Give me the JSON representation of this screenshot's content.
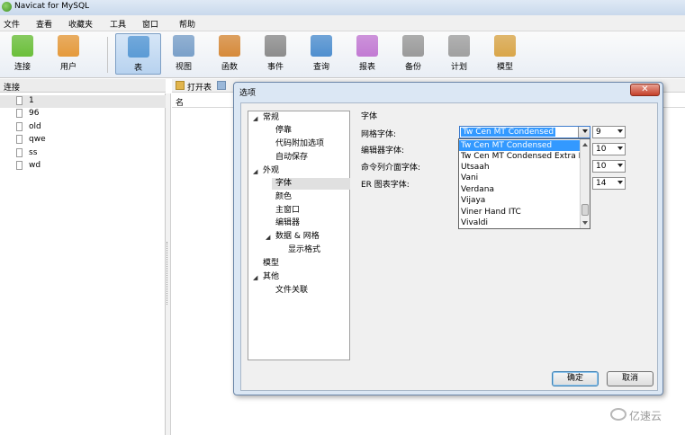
{
  "window": {
    "title": "Navicat for MySQL"
  },
  "menubar": [
    "文件",
    "查看",
    "收藏夹",
    "工具",
    "窗口",
    "帮助"
  ],
  "toolbar": [
    {
      "label": "连接",
      "icon": "connection-icon",
      "color": "#6bbf3a"
    },
    {
      "label": "用户",
      "icon": "user-icon",
      "color": "#e59a3c"
    },
    {
      "label": "表",
      "icon": "table-icon",
      "color": "#5b9bd5",
      "active": true
    },
    {
      "label": "视图",
      "icon": "view-icon",
      "color": "#7aa0c9"
    },
    {
      "label": "函数",
      "icon": "function-icon",
      "color": "#d68a3a"
    },
    {
      "label": "事件",
      "icon": "event-icon",
      "color": "#8c8c8c"
    },
    {
      "label": "查询",
      "icon": "query-icon",
      "color": "#4f8fcf"
    },
    {
      "label": "报表",
      "icon": "report-icon",
      "color": "#c27ad3"
    },
    {
      "label": "备份",
      "icon": "backup-icon",
      "color": "#9a9a9a"
    },
    {
      "label": "计划",
      "icon": "schedule-icon",
      "color": "#a0a0a0"
    },
    {
      "label": "模型",
      "icon": "model-icon",
      "color": "#d9a64a"
    }
  ],
  "left_panel": {
    "header": "连接",
    "connections": [
      "1",
      "96",
      "old",
      "qwe",
      "ss",
      "wd"
    ]
  },
  "object_toolbar": {
    "open_table": "打开表"
  },
  "list": {
    "column_name": "名"
  },
  "dialog": {
    "title": "选项",
    "close_label": "✕",
    "tree": [
      {
        "label": "常规",
        "level": 0,
        "expanded": true
      },
      {
        "label": "停靠",
        "level": 1
      },
      {
        "label": "代码附加选项",
        "level": 1
      },
      {
        "label": "自动保存",
        "level": 1
      },
      {
        "label": "外观",
        "level": 0,
        "expanded": true
      },
      {
        "label": "字体",
        "level": 1,
        "selected": true
      },
      {
        "label": "颜色",
        "level": 1
      },
      {
        "label": "主窗口",
        "level": 1
      },
      {
        "label": "编辑器",
        "level": 1
      },
      {
        "label": "数据 & 网格",
        "level": 1,
        "expanded": true
      },
      {
        "label": "显示格式",
        "level": 2
      },
      {
        "label": "模型",
        "level": 0
      },
      {
        "label": "其他",
        "level": 0,
        "expanded": true
      },
      {
        "label": "文件关联",
        "level": 1
      }
    ],
    "section_title": "字体",
    "fields": [
      {
        "label": "网格字体:",
        "font": "Tw Cen MT Condensed",
        "size": "9"
      },
      {
        "label": "编辑器字体:",
        "font": "",
        "size": "10"
      },
      {
        "label": "命令列介面字体:",
        "font": "",
        "size": "10"
      },
      {
        "label": "ER 图表字体:",
        "font": "",
        "size": "14"
      }
    ],
    "dropdown_options": [
      "Tw Cen MT Condensed",
      "Tw Cen MT Condensed Extra B",
      "Utsaah",
      "Vani",
      "Verdana",
      "Vijaya",
      "Viner Hand ITC",
      "Vivaldi"
    ],
    "dropdown_highlight_index": 0,
    "ok_label": "确定",
    "cancel_label": "取消"
  },
  "watermark": {
    "text": "亿速云"
  }
}
